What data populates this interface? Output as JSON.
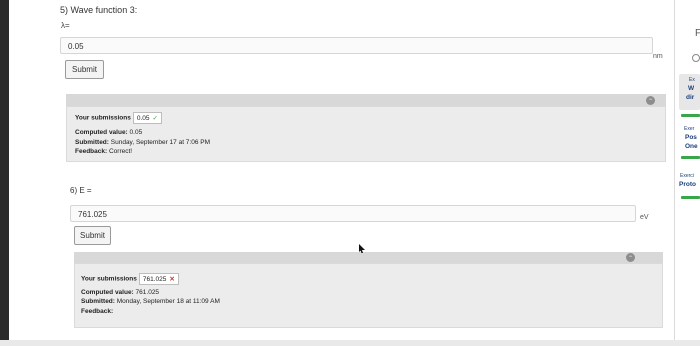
{
  "q5": {
    "title": "5) Wave function 3:",
    "label": "λ=",
    "value": "0.05",
    "unit": "nm",
    "submit": "Submit",
    "panel": {
      "submission_label": "Your submissions",
      "submission_value": "0.05",
      "computed_label": "Computed value:",
      "computed_value": "0.05",
      "submitted_label": "Submitted:",
      "submitted_value": "Sunday, September 17 at 7:06 PM",
      "feedback_label": "Feedback:",
      "feedback_value": "Correct!"
    }
  },
  "q6": {
    "label": "6) E =",
    "value": "761.025",
    "unit": "eV",
    "submit": "Submit",
    "panel": {
      "submission_label": "Your submissions",
      "submission_value": "761.025",
      "computed_label": "Computed value:",
      "computed_value": "761.025",
      "submitted_label": "Submitted:",
      "submitted_value": "Monday, September 18 at 11:09 AM",
      "feedback_label": "Feedback:"
    }
  },
  "sidebar": {
    "top_letter": "F",
    "card1": {
      "line1": "Ex",
      "line2": "W",
      "line3": "dir"
    },
    "card2": {
      "line1": "Exer",
      "line2": "Pos",
      "line3": "One"
    },
    "card3": {
      "line1": "Exerci",
      "line2": "Proto"
    }
  },
  "colors": {
    "correct": "#3a9b3a",
    "incorrect": "#c0392b",
    "progress": "#3aa64a",
    "link": "#1c3e7a"
  }
}
